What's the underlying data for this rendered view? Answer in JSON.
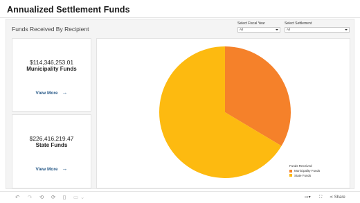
{
  "page": {
    "title": "Annualized Settlement Funds"
  },
  "dashboard": {
    "title": "Funds Received By Recipient",
    "filters": [
      {
        "label": "Select Fiscal Year",
        "value": "All"
      },
      {
        "label": "Select Settlement",
        "value": "All"
      }
    ],
    "cards": [
      {
        "amount": "$114,346,253.01",
        "label": "Municipality Funds",
        "link": "View More"
      },
      {
        "amount": "$226,416,219.47",
        "label": "State Funds",
        "link": "View More"
      }
    ]
  },
  "chart_data": {
    "type": "pie",
    "categories": [
      "Municipality Funds",
      "State Funds"
    ],
    "values": [
      114346253.01,
      226416219.47
    ],
    "colors": [
      "#f5812a",
      "#fdba10"
    ],
    "legend_title": "Funds Received",
    "legend_position": "bottom-right"
  },
  "toolbar": {
    "left_icons": [
      "undo-icon",
      "redo-icon",
      "revert-icon",
      "refresh-icon",
      "pause-icon",
      "device-icon",
      "more-icon"
    ],
    "comment_icon": "comment-icon",
    "fullscreen_icon": "fullscreen-icon",
    "share_label": "Share"
  }
}
